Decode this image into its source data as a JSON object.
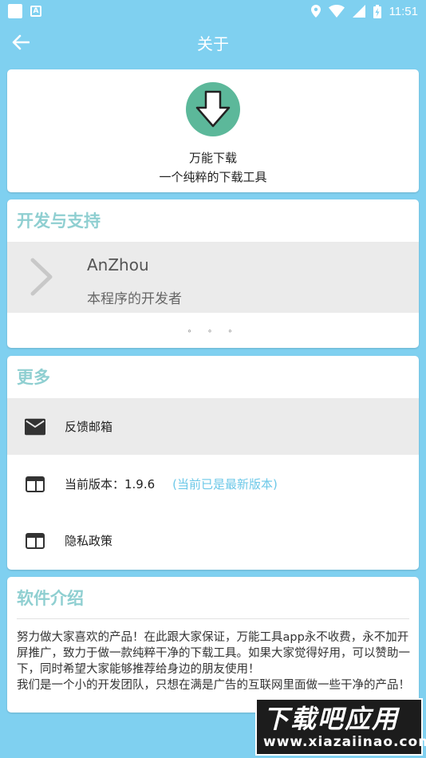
{
  "status_bar": {
    "time": "11:51"
  },
  "toolbar": {
    "title": "关于"
  },
  "app_card": {
    "name": "万能下载",
    "slogan": "一个纯粹的下载工具"
  },
  "dev_card": {
    "title": "开发与支持",
    "developer_name": "AnZhou",
    "developer_role": "本程序的开发者",
    "pager": "∘ ∘ ∘"
  },
  "more_card": {
    "title": "更多",
    "feedback_label": "反馈邮箱",
    "version_label": "当前版本：1.9.6",
    "version_note": "(当前已是最新版本)",
    "privacy_label": "隐私政策"
  },
  "intro_card": {
    "title": "软件介绍",
    "paragraph_1": "努力做大家喜欢的产品！在此跟大家保证，万能工具app永不收费，永不加开屏推广，致力于做一款纯粹干净的下载工具。如果大家觉得好用，可以赞助一下，同时希望大家能够推荐给身边的朋友使用！",
    "paragraph_2": "我们是一个小的开发团队，只想在满是广告的互联网里面做一些干净的产品！"
  },
  "watermark": {
    "title": "下载吧应用",
    "url": "www.xiazaiinao.com"
  },
  "colors": {
    "background": "#7fd0f0",
    "accent_header": "#8fcfd1",
    "logo": "#5cb89a",
    "version_note": "#6cc8e8",
    "row_highlight": "#ebebeb"
  },
  "icons": [
    "back-arrow-icon",
    "download-arrow-icon",
    "chevron-right-icon",
    "mail-icon",
    "window-icon",
    "location-icon",
    "wifi-icon",
    "cell-signal-icon",
    "battery-icon"
  ]
}
